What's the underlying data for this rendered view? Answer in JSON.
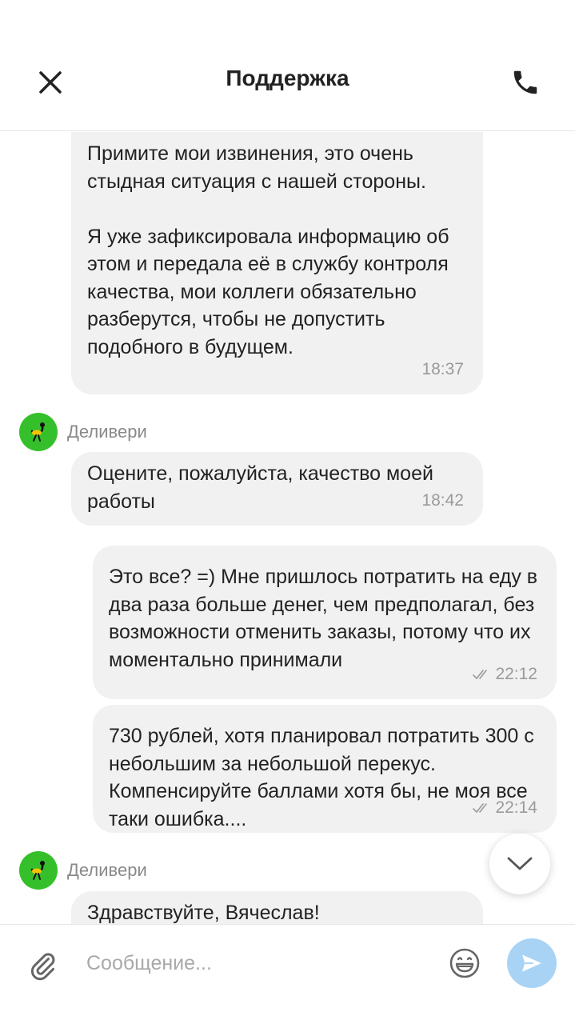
{
  "header": {
    "title": "Поддержка",
    "close_icon": "close-icon",
    "call_icon": "phone-icon"
  },
  "messages": [
    {
      "from": "agent",
      "text": "Примите мои извинения, это очень стыдная ситуация с нашей стороны.\n\nЯ уже зафиксировала информацию об этом и передала её в службу контроля качества, мои коллеги обязательно разберутся, чтобы не допустить подобного в будущем.",
      "time": "18:37"
    },
    {
      "from": "agent",
      "sender": "Деливери",
      "text": "Оцените, пожалуйста, качество моей работы",
      "time": "18:42"
    },
    {
      "from": "user",
      "text": "Это все? =) Мне пришлось потратить на еду в два раза больше денег, чем предполагал, без возможности отменить заказы, потому что их моментально принимали",
      "time": "22:12",
      "status_icon": "double-check-icon"
    },
    {
      "from": "user",
      "text": "730 рублей, хотя планировал потратить 300 с небольшим за небольшой перекус. Компенсируйте баллами хотя бы, не моя все таки ошибка....",
      "time": "22:14",
      "status_icon": "double-check-icon"
    },
    {
      "from": "agent",
      "sender": "Деливери",
      "text": "Здравствуйте, Вячеслав!",
      "time": ""
    }
  ],
  "composer": {
    "placeholder": "Сообщение...",
    "value": ""
  },
  "colors": {
    "bubble_bg": "#f1f1f1",
    "avatar_bg": "#35c02b",
    "send_button_bg": "#a9d3f5",
    "muted_text": "#9a9a9a"
  }
}
